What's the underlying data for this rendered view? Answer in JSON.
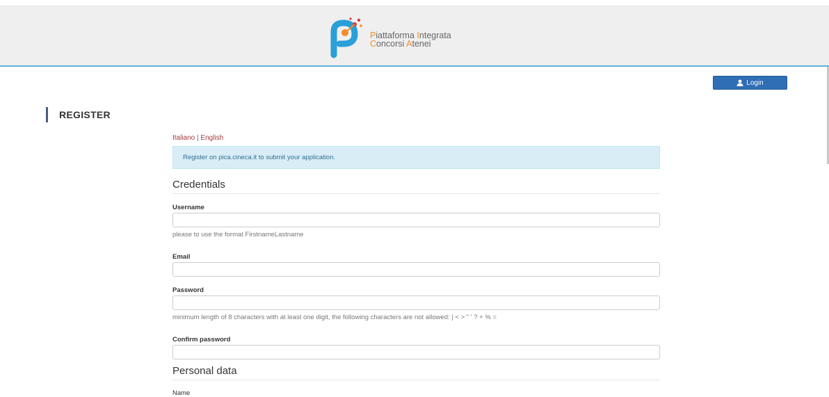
{
  "header": {
    "logo": {
      "line1": [
        {
          "text": "P",
          "accent": true
        },
        {
          "text": "iattaforma ",
          "accent": false
        },
        {
          "text": "I",
          "accent": true
        },
        {
          "text": "ntegrata",
          "accent": false
        }
      ],
      "line2": [
        {
          "text": "C",
          "accent": true
        },
        {
          "text": "oncorsi ",
          "accent": false
        },
        {
          "text": "A",
          "accent": true
        },
        {
          "text": "tenei",
          "accent": false
        }
      ],
      "colors": {
        "primary": "#2a9fd8",
        "accent": "#f28c28",
        "dot": "#d83a3a"
      }
    },
    "login": {
      "label": "Login",
      "icon": "user-icon"
    }
  },
  "page": {
    "title": "REGISTER",
    "lang": {
      "it": "Italiano",
      "separator": " | ",
      "en": "English"
    },
    "alert": "Register on pica.cineca.it to submit your application."
  },
  "credentials": {
    "title": "Credentials",
    "username": {
      "label": "Username",
      "value": "",
      "help": "please to use the format FirstnameLastname"
    },
    "email": {
      "label": "Email",
      "value": ""
    },
    "password": {
      "label": "Password",
      "value": "",
      "help": "minimum length of 8 characters with at least one digit, the following characters are not allowed: | < > \" ' ? + % ="
    },
    "confirm": {
      "label": "Confirm password",
      "value": ""
    }
  },
  "personal": {
    "title": "Personal data",
    "next_label": "Name"
  }
}
